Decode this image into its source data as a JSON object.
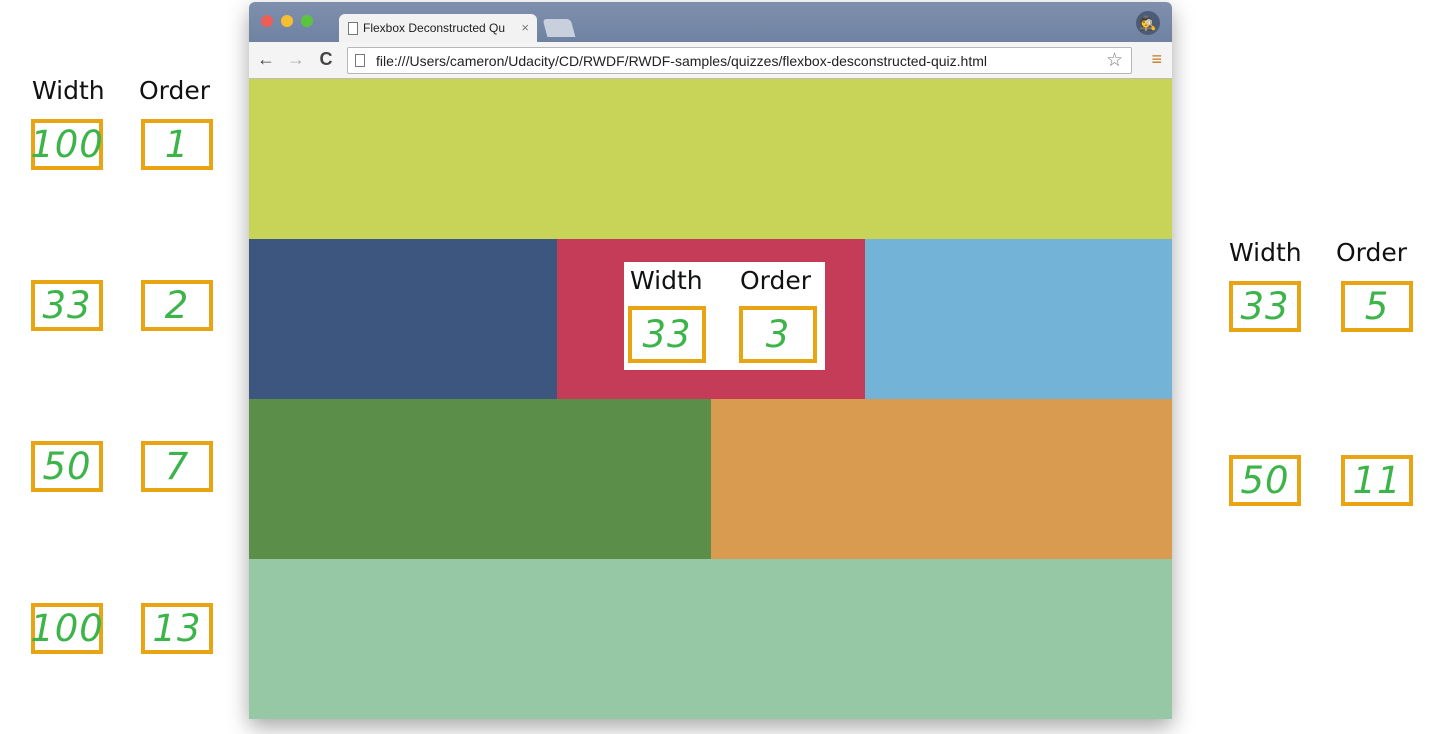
{
  "left_panel": {
    "header_width": "Width",
    "header_order": "Order",
    "rows": [
      {
        "width": "100",
        "order": "1"
      },
      {
        "width": "33",
        "order": "2"
      },
      {
        "width": "50",
        "order": "7"
      },
      {
        "width": "100",
        "order": "13"
      }
    ]
  },
  "right_panel": {
    "header_width": "Width",
    "header_order": "Order",
    "rows": [
      {
        "width": "33",
        "order": "5"
      },
      {
        "width": "50",
        "order": "11"
      }
    ]
  },
  "browser": {
    "tab_title": "Flexbox Deconstructed Qu",
    "tab_close": "×",
    "url": "file:///Users/cameron/Udacity/CD/RWDF/RWDF-samples/quizzes/flexbox-desconstructed-quiz.html",
    "back": "←",
    "forward": "→",
    "reload": "C",
    "star": "☆",
    "menu": "≡",
    "incognito": "🕵",
    "icons": {
      "back": "back-arrow-icon",
      "forward": "forward-arrow-icon",
      "reload": "reload-icon",
      "star": "bookmark-star-icon",
      "menu": "hamburger-menu-icon",
      "doc": "document-icon",
      "incognito": "incognito-icon"
    }
  },
  "page": {
    "boxes_colors": {
      "yellow": "#c8d458",
      "navy": "#3c5680",
      "red": "#c43c58",
      "blue": "#74b3d8",
      "green": "#5b8e49",
      "orange": "#d99b4f",
      "mint": "#96c8a6"
    },
    "center_quiz": {
      "header_width": "Width",
      "header_order": "Order",
      "width": "33",
      "order": "3"
    }
  },
  "colors": {
    "box_border": "#e8a412",
    "handwriting": "#3cb449"
  }
}
